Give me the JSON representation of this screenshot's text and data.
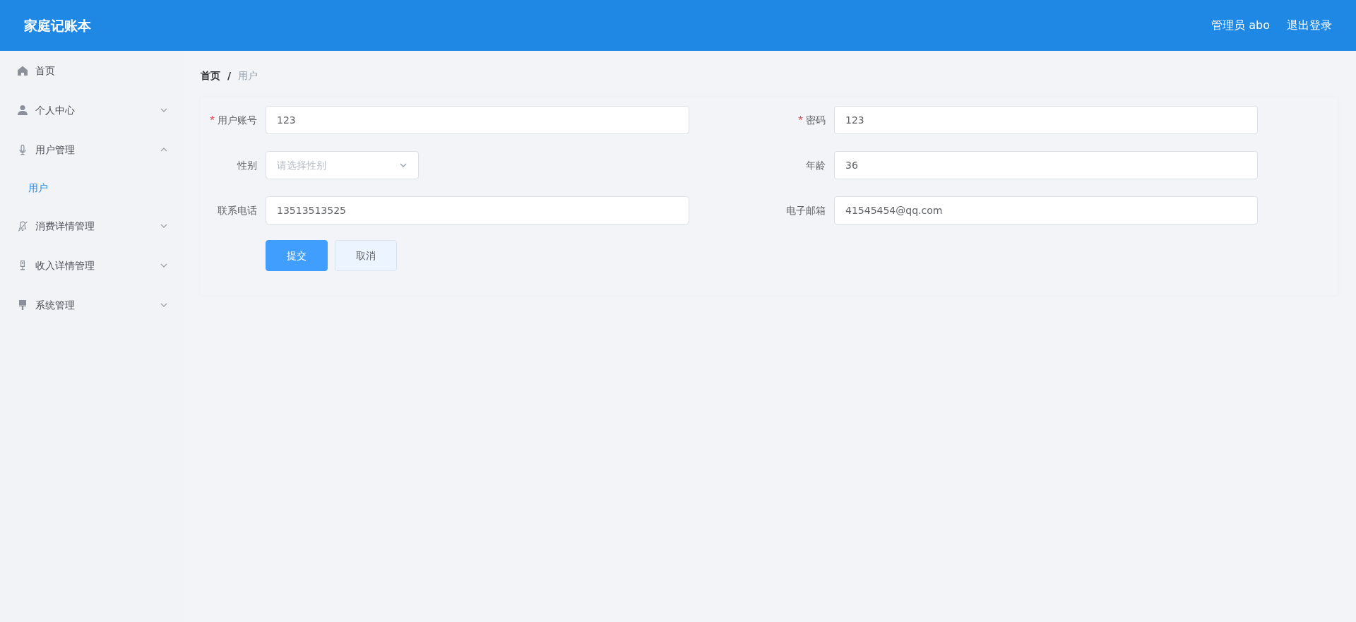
{
  "header": {
    "title": "家庭记账本",
    "user": "管理员 abo",
    "logout": "退出登录"
  },
  "sidebar": {
    "items": [
      {
        "label": "首页",
        "kind": "link"
      },
      {
        "label": "个人中心",
        "kind": "submenu",
        "expanded": false
      },
      {
        "label": "用户管理",
        "kind": "submenu",
        "expanded": true,
        "children": [
          {
            "label": "用户",
            "selected": true
          }
        ]
      },
      {
        "label": "消费详情管理",
        "kind": "submenu",
        "expanded": false
      },
      {
        "label": "收入详情管理",
        "kind": "submenu",
        "expanded": false
      },
      {
        "label": "系统管理",
        "kind": "submenu",
        "expanded": false
      }
    ]
  },
  "breadcrumb": {
    "items": [
      "首页",
      "用户"
    ],
    "separator": "/"
  },
  "form": {
    "fields": [
      {
        "label": "用户账号",
        "required": true,
        "kind": "input",
        "value": "123"
      },
      {
        "label": "密码",
        "required": true,
        "kind": "input",
        "value": "123"
      },
      {
        "label": "性别",
        "required": false,
        "kind": "select",
        "placeholder": "请选择性别"
      },
      {
        "label": "年龄",
        "required": false,
        "kind": "input",
        "value": "36"
      },
      {
        "label": "联系电话",
        "required": false,
        "kind": "input",
        "value": "13513513525"
      },
      {
        "label": "电子邮箱",
        "required": false,
        "kind": "input",
        "value": "41545454@qq.com"
      }
    ],
    "buttons": [
      {
        "label": "提交",
        "kind": "primary"
      },
      {
        "label": "取消",
        "kind": "secondary"
      }
    ]
  }
}
